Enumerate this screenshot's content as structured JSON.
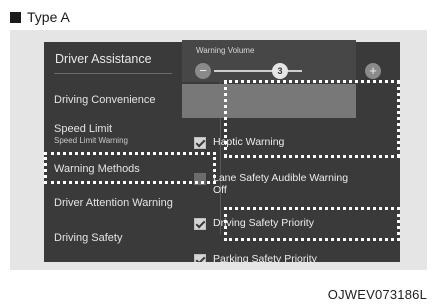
{
  "type_label": "Type A",
  "screen": {
    "title": "Driver Assistance",
    "menu": [
      {
        "label": "Driving Convenience"
      },
      {
        "label": "Speed Limit",
        "sublabel": "Speed Limit Warning"
      },
      {
        "label": "Warning Methods"
      },
      {
        "label": "Driver Attention Warning"
      },
      {
        "label": "Driving Safety"
      }
    ],
    "warning_volume": {
      "label": "Warning Volume",
      "minus": "−",
      "plus": "+",
      "value": "3",
      "level_fraction": 0.75
    },
    "settings": [
      {
        "label": "Haptic Warning",
        "checked": true
      },
      {
        "label": "Lane Safety Audible Warning Off",
        "checked": false
      },
      {
        "label": "Driving Safety Priority",
        "checked": true
      },
      {
        "label": "Parking Safety Priority",
        "checked": true
      }
    ]
  },
  "reference_code": "OJWEV073186L",
  "colors": {
    "screen_bg": "#3a3a3a",
    "highlight_bg": "#787878",
    "dotted_outline": "#ffffff"
  }
}
